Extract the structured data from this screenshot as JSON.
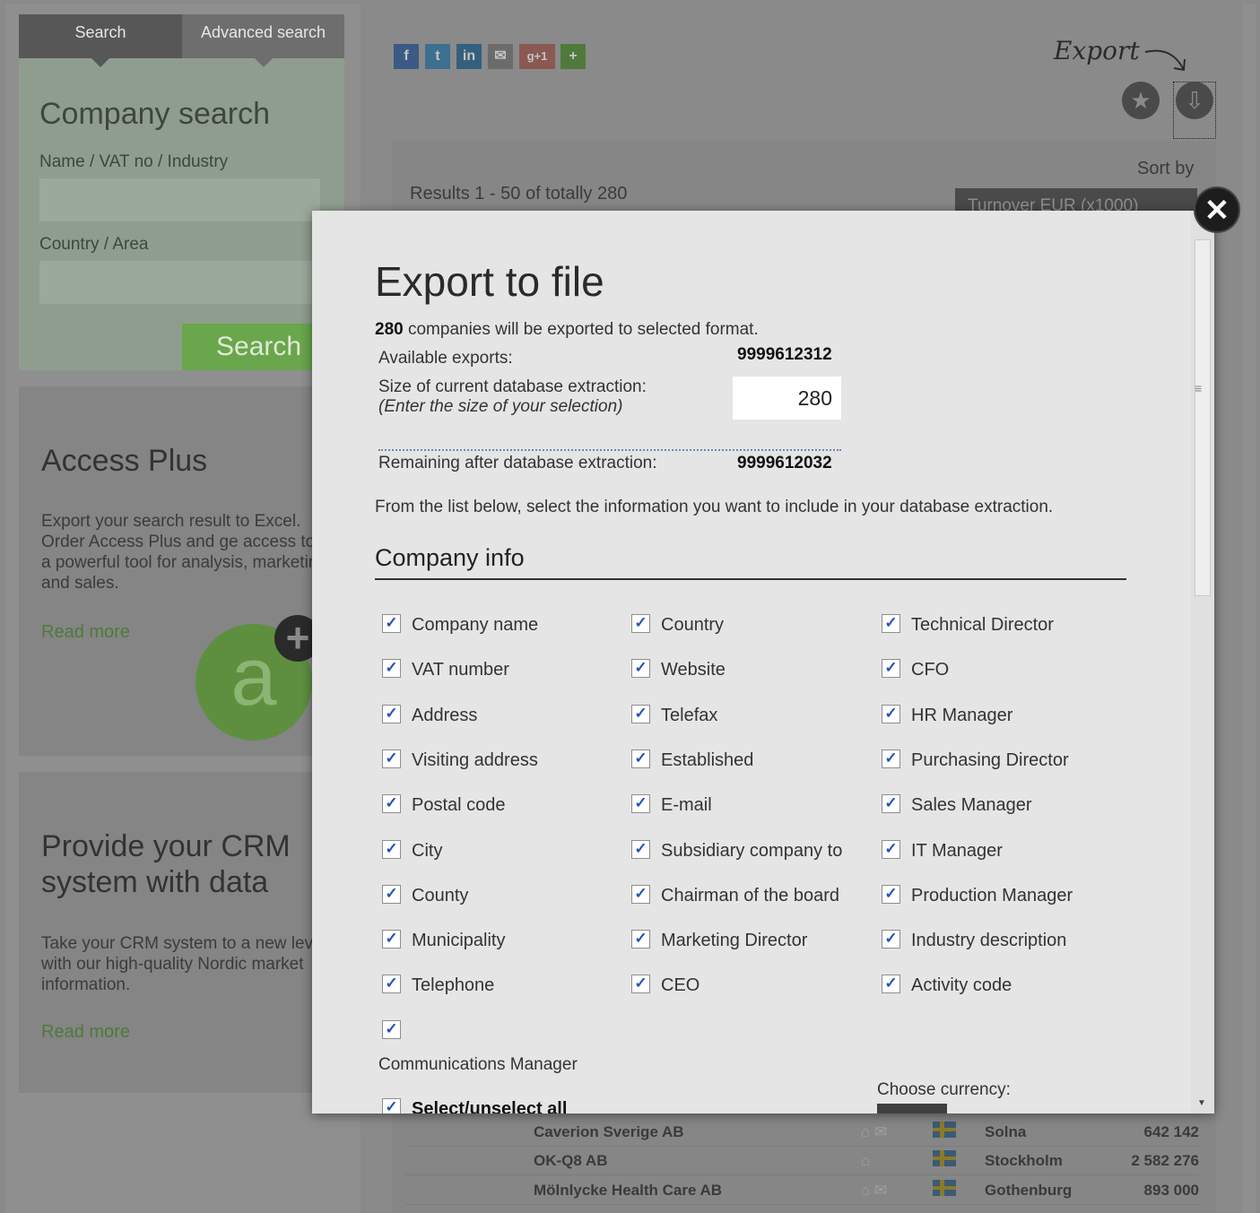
{
  "search_panel": {
    "tabs": [
      "Search",
      "Advanced search"
    ],
    "title": "Company search",
    "name_label": "Name / VAT no / Industry",
    "country_label": "Country / Area",
    "button": "Search"
  },
  "promos": [
    {
      "title": "Access Plus",
      "text": "Export your search result to Excel. Order Access Plus and ge access to a powerful tool for analysis, marketing and sales.",
      "link": "Read more",
      "logo_letter": "a"
    },
    {
      "title": "Provide your CRM system with data",
      "text": "Take your CRM system to a new level with our high-quality Nordic market information.",
      "link": "Read more"
    }
  ],
  "share_icons": [
    {
      "icon": "facebook-icon",
      "glyph": "f",
      "color": "#3b5a86"
    },
    {
      "icon": "twitter-icon",
      "glyph": "t",
      "color": "#3d6f8f"
    },
    {
      "icon": "linkedin-icon",
      "glyph": "in",
      "color": "#34607f"
    },
    {
      "icon": "email-icon",
      "glyph": "✉",
      "color": "#6b6b6b"
    },
    {
      "icon": "googleplus-icon",
      "glyph": "g+1",
      "color": "#8a5a52"
    },
    {
      "icon": "addthis-icon",
      "glyph": "+",
      "color": "#4f7a3c"
    }
  ],
  "export_hint": "Export",
  "results": {
    "summary": "Results 1 - 50 of totally 280",
    "sort_label": "Sort by",
    "sort_value": "Turnover EUR (x1000)"
  },
  "rows": [
    {
      "name": "Caverion Sverige AB",
      "icons": "⌂ ✉",
      "city": "Solna",
      "value": "642 142"
    },
    {
      "name": "OK-Q8 AB",
      "icons": "⌂",
      "city": "Stockholm",
      "value": "2 582 276"
    },
    {
      "name": "Mölnlycke Health Care AB",
      "icons": "⌂ ✉",
      "city": "Gothenburg",
      "value": "893 000"
    }
  ],
  "modal": {
    "close_glyph": "✕",
    "title": "Export to file",
    "count": "280",
    "summary_rest": " companies will be exported to selected format.",
    "available_label": "Available exports:",
    "available_value": "9999612312",
    "size_label": "Size of current database extraction:",
    "size_hint": "(Enter the size of your selection)",
    "size_value": "280",
    "remaining_label": "Remaining after database extraction:",
    "remaining_value": "9999612032",
    "instruction": "From the list below, select the information you want to include in your database extraction.",
    "section": "Company info",
    "checkbox_columns": [
      [
        "Company name",
        "VAT number",
        "Address",
        "Visiting address",
        "Postal code",
        "City",
        "County",
        "Municipality",
        "Telephone",
        ""
      ],
      [
        "Country",
        "Website",
        "Telefax",
        "Established",
        "E-mail",
        "Subsidiary company to",
        "Chairman of the board",
        "Marketing Director",
        "CEO"
      ],
      [
        "Technical Director",
        "CFO",
        "HR Manager",
        "Purchasing Director",
        "Sales Manager",
        "IT Manager",
        "Production Manager",
        "Industry description",
        "Activity code"
      ]
    ],
    "comm_label": "Communications Manager",
    "select_all": "Select/unselect all",
    "currency_label": "Choose currency:"
  }
}
